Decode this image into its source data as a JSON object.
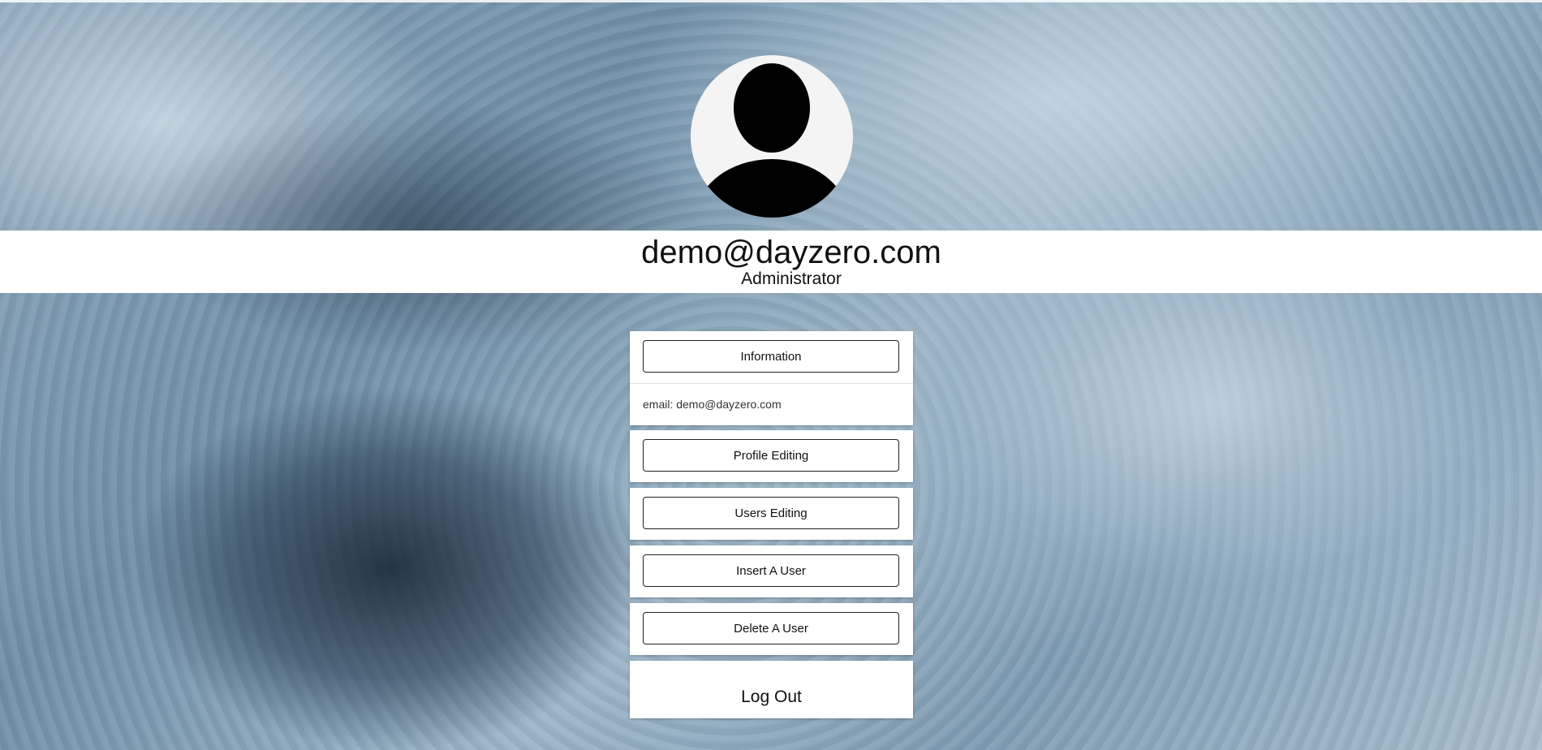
{
  "profile": {
    "email": "demo@dayzero.com",
    "role": "Administrator"
  },
  "info_panel": {
    "button_label": "Information",
    "email_line": "email: demo@dayzero.com"
  },
  "menu": {
    "profile_editing": "Profile Editing",
    "users_editing": "Users Editing",
    "insert_user": "Insert A User",
    "delete_user": "Delete A User",
    "logout": "Log Out"
  },
  "icons": {
    "avatar": "user-silhouette-icon"
  },
  "colors": {
    "panel_background": "#ffffff",
    "button_border": "#222222",
    "avatar_background": "#f4f4f4"
  }
}
